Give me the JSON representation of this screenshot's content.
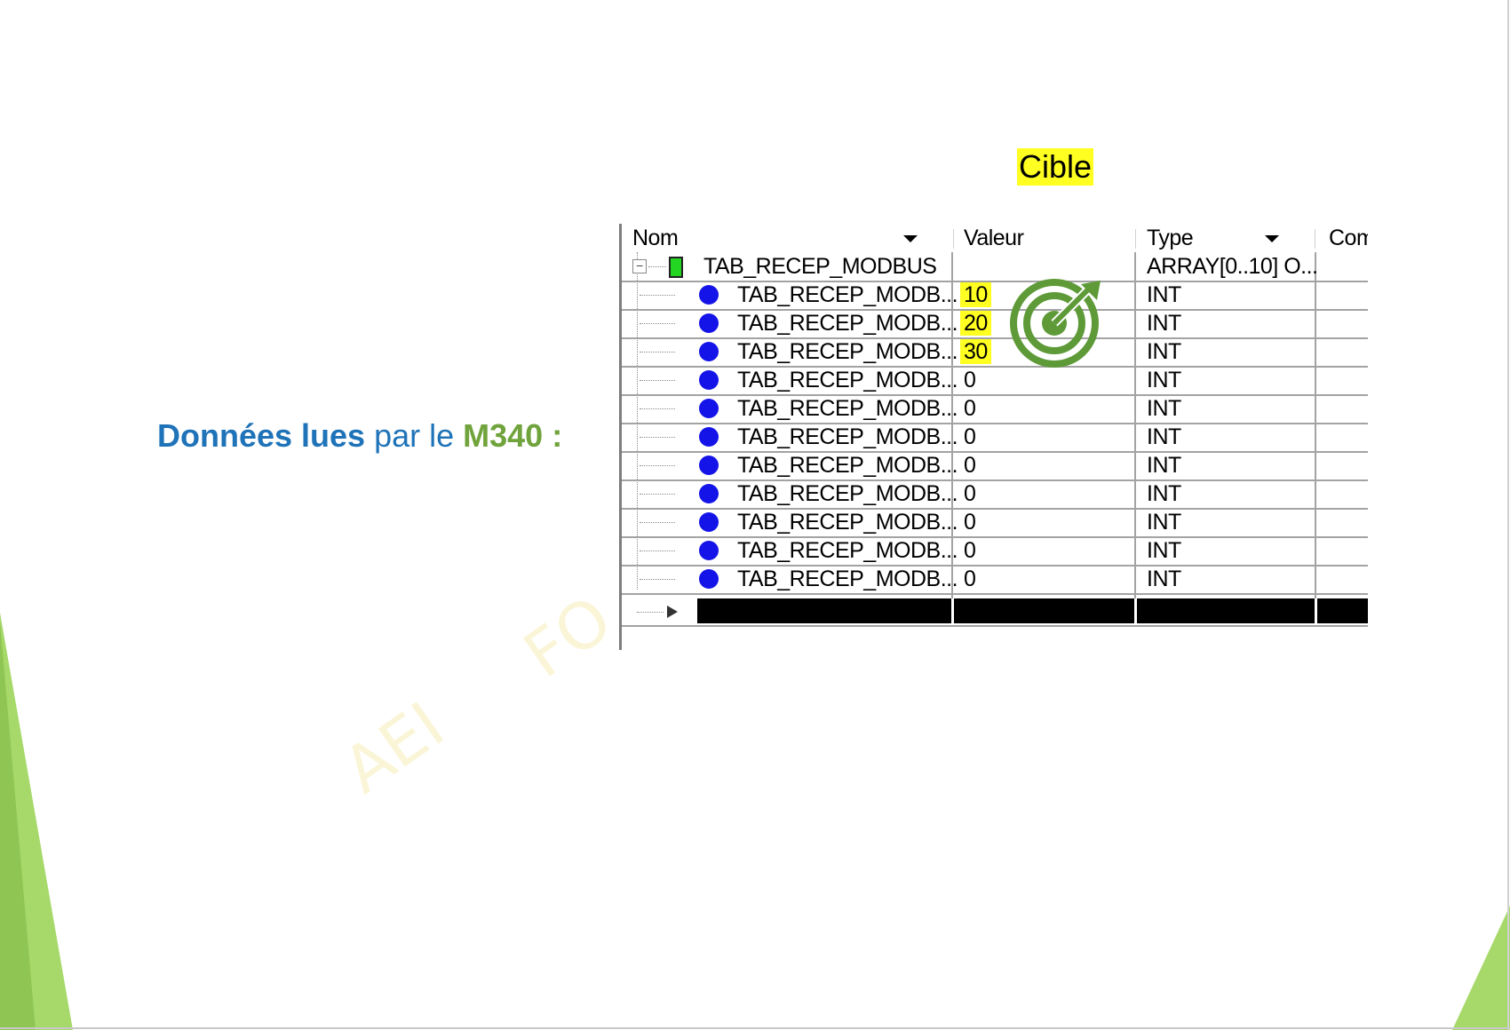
{
  "slide": {
    "heading": {
      "part1": "Données lues",
      "part2": " par le ",
      "part3": "M340 :"
    },
    "cible_label": "Cible",
    "watermark": [
      "AEI",
      "FO"
    ],
    "target_icon": "target-arrow-icon"
  },
  "table": {
    "columns": [
      "Nom",
      "Valeur",
      "Type",
      "Comi"
    ],
    "parent": {
      "name": "TAB_RECEP_MODBUS",
      "value": "",
      "type": "ARRAY[0..10] O..."
    },
    "rows": [
      {
        "name": "TAB_RECEP_MODB...",
        "value": "10",
        "type": "INT",
        "highlight": true
      },
      {
        "name": "TAB_RECEP_MODB...",
        "value": "20",
        "type": "INT",
        "highlight": true
      },
      {
        "name": "TAB_RECEP_MODB...",
        "value": "30",
        "type": "INT",
        "highlight": true
      },
      {
        "name": "TAB_RECEP_MODB...",
        "value": "0",
        "type": "INT",
        "highlight": false
      },
      {
        "name": "TAB_RECEP_MODB...",
        "value": "0",
        "type": "INT",
        "highlight": false
      },
      {
        "name": "TAB_RECEP_MODB...",
        "value": "0",
        "type": "INT",
        "highlight": false
      },
      {
        "name": "TAB_RECEP_MODB...",
        "value": "0",
        "type": "INT",
        "highlight": false
      },
      {
        "name": "TAB_RECEP_MODB...",
        "value": "0",
        "type": "INT",
        "highlight": false
      },
      {
        "name": "TAB_RECEP_MODB...",
        "value": "0",
        "type": "INT",
        "highlight": false
      },
      {
        "name": "TAB_RECEP_MODB...",
        "value": "0",
        "type": "INT",
        "highlight": false
      },
      {
        "name": "TAB_RECEP_MODB...",
        "value": "0",
        "type": "INT",
        "highlight": false
      }
    ]
  },
  "colors": {
    "blue_text": "#1f73b8",
    "green_text": "#70a33c",
    "highlight": "#ffff22",
    "accent_green": "#8fd14f",
    "target_green": "#5e9a38"
  }
}
